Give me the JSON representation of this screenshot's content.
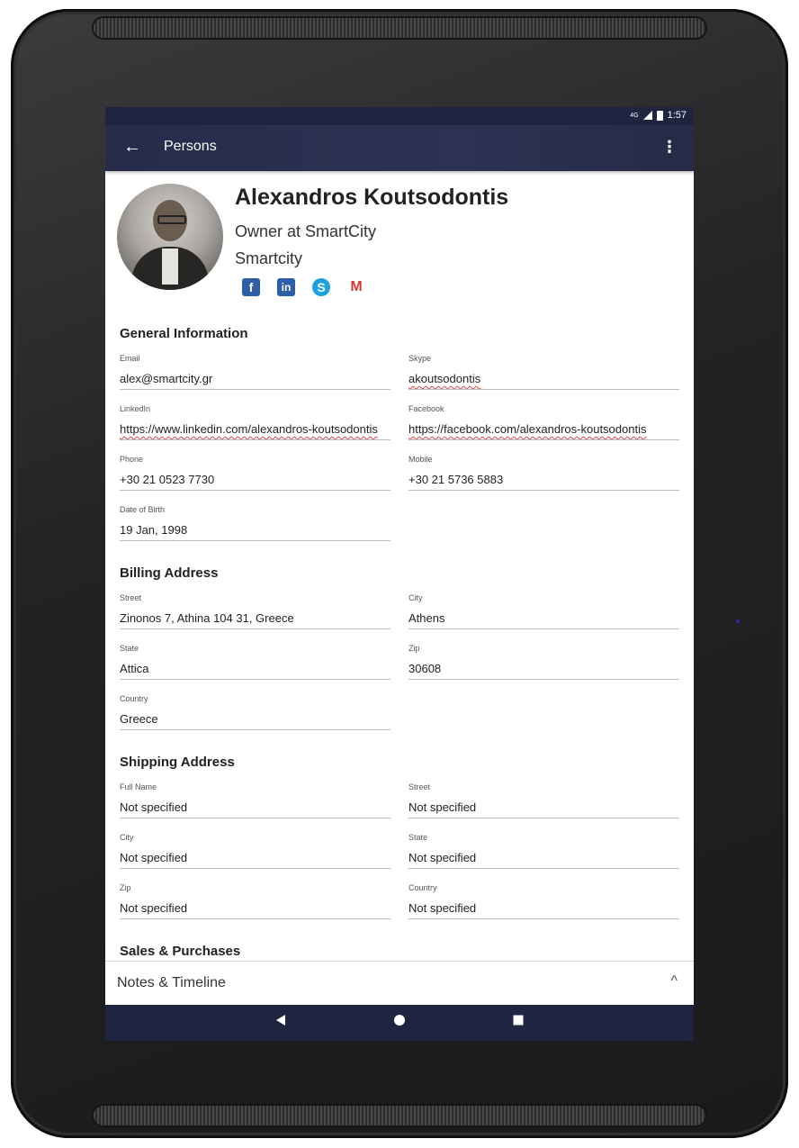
{
  "status": {
    "network": "4G",
    "time": "1:57"
  },
  "appbar": {
    "title": "Persons"
  },
  "profile": {
    "name": "Alexandros Koutsodontis",
    "role": "Owner at SmartCity",
    "company": "Smartcity",
    "social": [
      "facebook-icon",
      "linkedin-icon",
      "skype-icon",
      "gmail-icon"
    ]
  },
  "general": {
    "title": "General Information",
    "email_label": "Email",
    "email": "alex@smartcity.gr",
    "skype_label": "Skype",
    "skype": "akoutsodontis",
    "linkedin_label": "LinkedIn",
    "linkedin": "https://www.linkedin.com/alexandros-koutsodontis",
    "facebook_label": "Facebook",
    "facebook": "https://facebook.com/alexandros-koutsodontis",
    "phone_label": "Phone",
    "phone": "+30 21 0523 7730",
    "mobile_label": "Mobile",
    "mobile": "+30 21 5736 5883",
    "dob_label": "Date of Birth",
    "dob": "19 Jan, 1998"
  },
  "billing": {
    "title": "Billing Address",
    "street_label": "Street",
    "street": "Zinonos 7, Athina 104 31, Greece",
    "city_label": "City",
    "city": "Athens",
    "state_label": "State",
    "state": "Attica",
    "zip_label": "Zip",
    "zip": "30608",
    "country_label": "Country",
    "country": "Greece"
  },
  "shipping": {
    "title": "Shipping Address",
    "fullname_label": "Full Name",
    "fullname": "Not specified",
    "street_label": "Street",
    "street": "Not specified",
    "city_label": "City",
    "city": "Not specified",
    "state_label": "State",
    "state": "Not specified",
    "zip_label": "Zip",
    "zip": "Not specified",
    "country_label": "Country",
    "country": "Not specified"
  },
  "sales": {
    "title": "Sales & Purchases"
  },
  "bottom": {
    "notes_label": "Notes & Timeline"
  },
  "colors": {
    "appbar": "#262c4a",
    "navbar": "#1f2540",
    "facebook": "#2d5fa8",
    "skype": "#1ba2e0",
    "gmail": "#d23b2d"
  }
}
